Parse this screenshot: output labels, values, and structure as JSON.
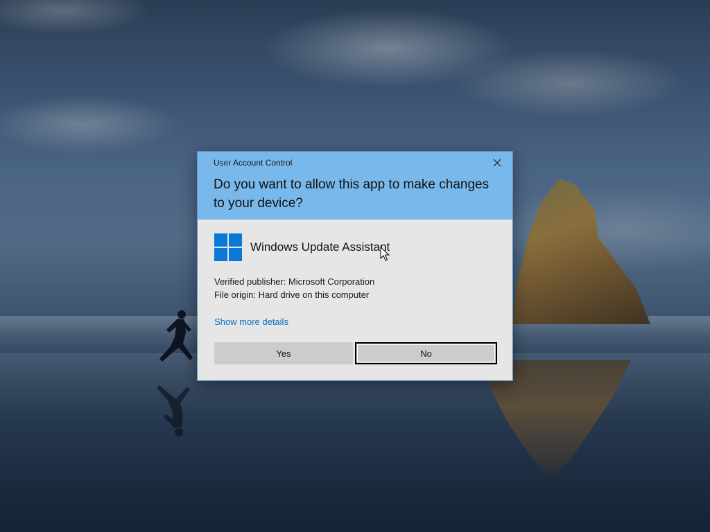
{
  "dialog": {
    "window_title": "User Account Control",
    "question": "Do you want to allow this app to make changes to your device?",
    "app_name": "Windows Update Assistant",
    "publisher": "Verified publisher: Microsoft Corporation",
    "file_origin": "File origin: Hard drive on this computer",
    "details_link": "Show more details",
    "yes_label": "Yes",
    "no_label": "No",
    "focused_button": "No"
  },
  "icons": {
    "close": "close-icon",
    "app": "windows-logo-icon",
    "pointer": "mouse-cursor-icon"
  },
  "colors": {
    "header": "#79b8ea",
    "body": "#e6e6e6",
    "link": "#0a6fc2",
    "logo": "#0a78d7",
    "button": "#cccccc"
  }
}
